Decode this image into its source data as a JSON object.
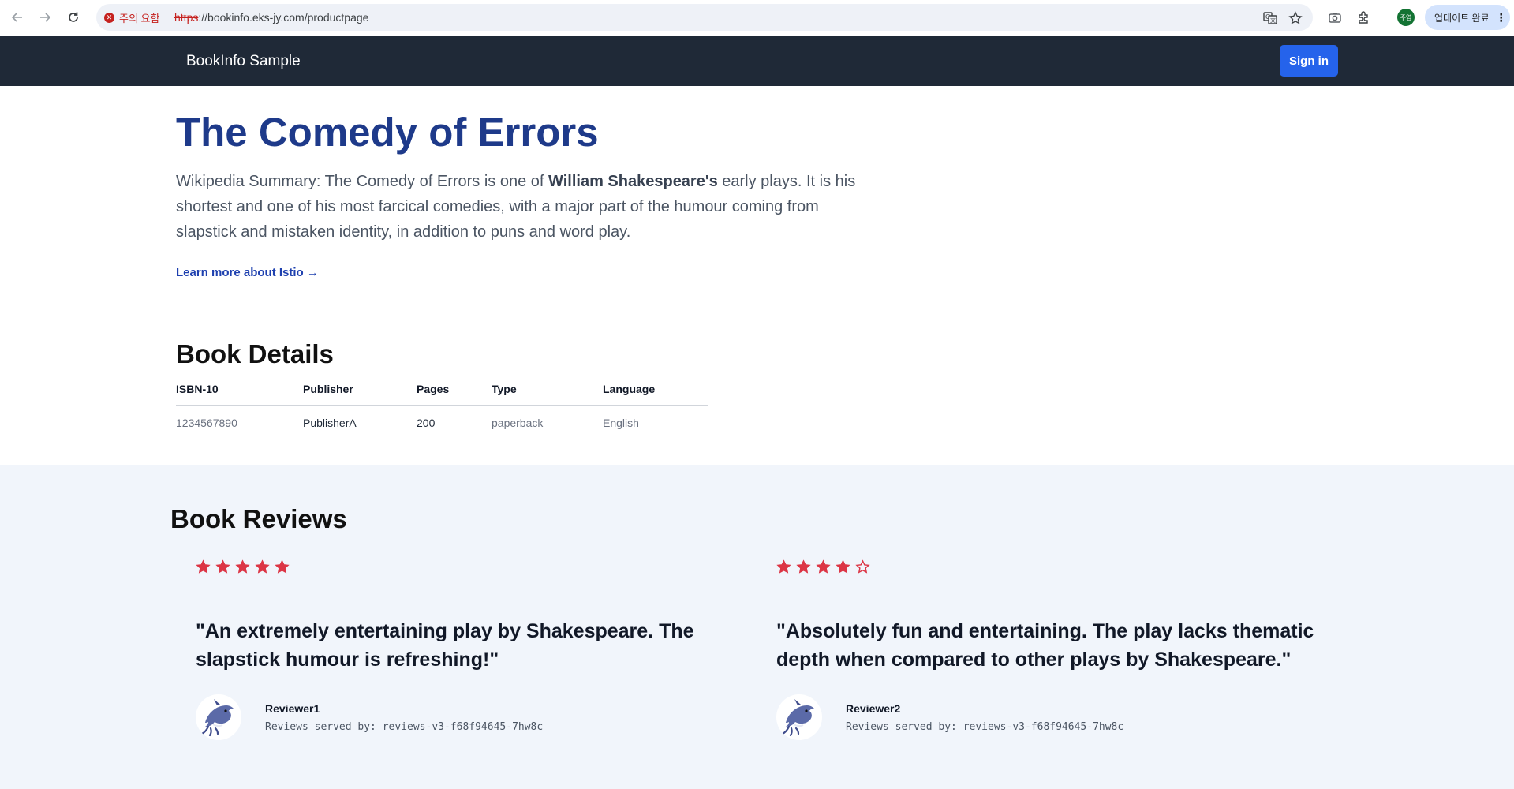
{
  "browser": {
    "security_label": "주의 요함",
    "url_scheme": "https",
    "url_rest": "://bookinfo.eks-jy.com/productpage",
    "profile_initials": "주영",
    "update_label": "업데이트 완료"
  },
  "navbar": {
    "brand": "BookInfo Sample",
    "signin_label": "Sign in"
  },
  "book": {
    "title": "The Comedy of Errors",
    "summary_prefix": "Wikipedia Summary: The Comedy of Errors is one of ",
    "summary_author": "William Shakespeare's",
    "summary_suffix": " early plays. It is his shortest and one of his most farcical comedies, with a major part of the humour coming from slapstick and mistaken identity, in addition to puns and word play.",
    "learn_more": "Learn more about Istio →"
  },
  "details": {
    "heading": "Book Details",
    "columns": [
      "ISBN-10",
      "Publisher",
      "Pages",
      "Type",
      "Language"
    ],
    "row": [
      "1234567890",
      "PublisherA",
      "200",
      "paperback",
      "English"
    ]
  },
  "reviews": {
    "heading": "Book Reviews",
    "star_color": "#dc3545",
    "items": [
      {
        "rating": 5,
        "max_rating": 5,
        "text": "\"An extremely entertaining play by Shakespeare. The slapstick humour is refreshing!\"",
        "reviewer": "Reviewer1",
        "served_by": "Reviews served by: reviews-v3-f68f94645-7hw8c"
      },
      {
        "rating": 4,
        "max_rating": 5,
        "text": "\"Absolutely fun and entertaining. The play lacks thematic depth when compared to other plays by Shakespeare.\"",
        "reviewer": "Reviewer2",
        "served_by": "Reviews served by: reviews-v3-f68f94645-7hw8c"
      }
    ]
  },
  "colors": {
    "navbar_bg": "#1f2937",
    "accent": "#2563eb",
    "title": "#1e3a8a",
    "reviews_bg": "#f1f5fb"
  },
  "icons": [
    "back-arrow-icon",
    "forward-arrow-icon",
    "reload-icon",
    "insecure-icon",
    "translate-icon",
    "bookmark-star-icon",
    "screenshot-icon",
    "extensions-icon",
    "more-vert-icon",
    "dolphin-avatar-icon",
    "star-filled-icon",
    "star-outline-icon"
  ]
}
